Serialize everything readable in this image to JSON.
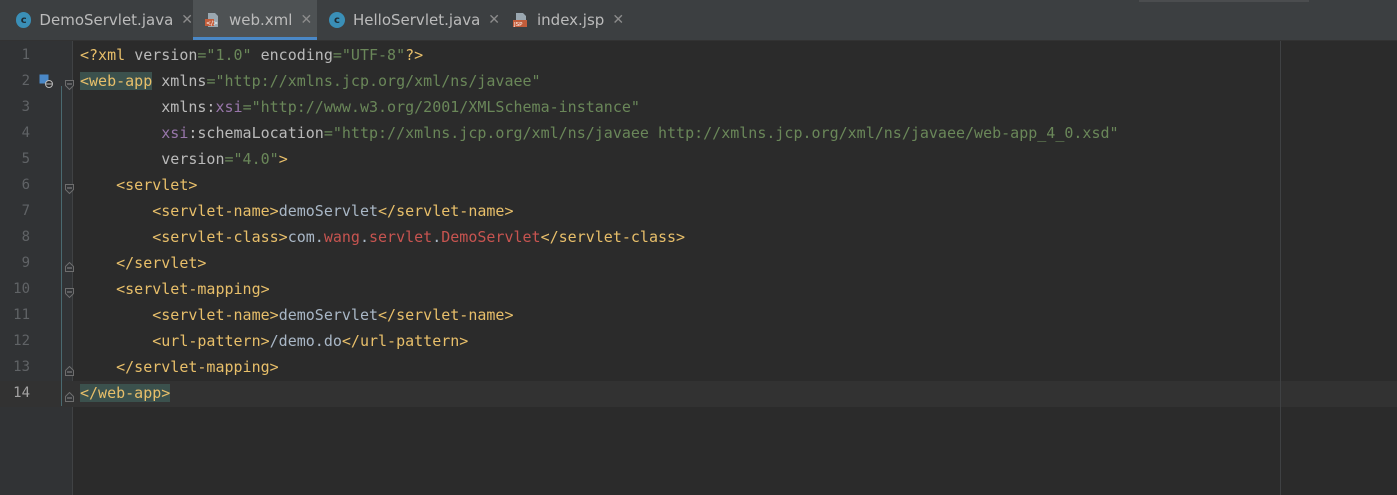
{
  "tabs": [
    {
      "label": "DemoServlet.java",
      "icon": "java-class-icon",
      "active": false
    },
    {
      "label": "web.xml",
      "icon": "xml-file-icon",
      "active": true
    },
    {
      "label": "HelloServlet.java",
      "icon": "java-class-icon",
      "active": false
    },
    {
      "label": "index.jsp",
      "icon": "jsp-file-icon",
      "active": false
    }
  ],
  "tab_close_glyph": "✕",
  "class_icon_letter": "c",
  "jsp_icon_text": "JSP",
  "colors": {
    "background": "#2b2b2b",
    "tag": "#e8bf6a",
    "attribute_value": "#6a8759",
    "namespace_prefix": "#9876aa",
    "active_tab_underline": "#4a88c7"
  },
  "editor": {
    "current_line": 14,
    "lines": [
      {
        "num": "1",
        "tokens": [
          [
            "t-tag",
            "<?xml "
          ],
          [
            "t-attr",
            "version"
          ],
          [
            "t-val",
            "=\"1.0\" "
          ],
          [
            "t-attr",
            "encoding"
          ],
          [
            "t-val",
            "=\"UTF-8\""
          ],
          [
            "t-tag",
            "?>"
          ]
        ]
      },
      {
        "num": "2",
        "tokens": [
          [
            "t-tag hl",
            "<web-app"
          ],
          [
            "t-attr",
            " xmlns"
          ],
          [
            "t-val",
            "=\"http://xmlns.jcp.org/xml/ns/javaee\""
          ]
        ]
      },
      {
        "num": "3",
        "tokens": [
          [
            "t-attr",
            "         xmlns:"
          ],
          [
            "t-ns",
            "xsi"
          ],
          [
            "t-val",
            "=\"http://www.w3.org/2001/XMLSchema-instance\""
          ]
        ]
      },
      {
        "num": "4",
        "tokens": [
          [
            "t-ns",
            "         xsi"
          ],
          [
            "t-attr",
            ":schemaLocation"
          ],
          [
            "t-val",
            "=\"http://xmlns.jcp.org/xml/ns/javaee http://xmlns.jcp.org/xml/ns/javaee/web-app_4_0.xsd\""
          ]
        ]
      },
      {
        "num": "5",
        "tokens": [
          [
            "t-attr",
            "         version"
          ],
          [
            "t-val",
            "=\"4.0\""
          ],
          [
            "t-tag",
            ">"
          ]
        ]
      },
      {
        "num": "6",
        "tokens": [
          [
            "t-tag",
            "    <servlet>"
          ]
        ]
      },
      {
        "num": "7",
        "tokens": [
          [
            "t-tag",
            "        <servlet-name>"
          ],
          [
            "t-txt",
            "demoServlet"
          ],
          [
            "t-tag",
            "</servlet-name>"
          ]
        ]
      },
      {
        "num": "8",
        "tokens": [
          [
            "t-tag",
            "        <servlet-class>"
          ],
          [
            "t-txt",
            "com."
          ],
          [
            "t-pkg",
            "wang"
          ],
          [
            "t-txt",
            "."
          ],
          [
            "t-pkg",
            "servlet"
          ],
          [
            "t-txt",
            "."
          ],
          [
            "t-pkg",
            "DemoServlet"
          ],
          [
            "t-tag",
            "</servlet-class>"
          ]
        ]
      },
      {
        "num": "9",
        "tokens": [
          [
            "t-tag",
            "    </servlet>"
          ]
        ]
      },
      {
        "num": "10",
        "tokens": [
          [
            "t-tag",
            "    <servlet-mapping>"
          ]
        ]
      },
      {
        "num": "11",
        "tokens": [
          [
            "t-tag",
            "        <servlet-name>"
          ],
          [
            "t-txt",
            "demoServlet"
          ],
          [
            "t-tag",
            "</servlet-name>"
          ]
        ]
      },
      {
        "num": "12",
        "tokens": [
          [
            "t-tag",
            "        <url-pattern>"
          ],
          [
            "t-txt",
            "/demo.do"
          ],
          [
            "t-tag",
            "</url-pattern>"
          ]
        ]
      },
      {
        "num": "13",
        "tokens": [
          [
            "t-tag",
            "    </servlet-mapping>"
          ]
        ]
      },
      {
        "num": "14",
        "tokens": [
          [
            "t-tag hl",
            "</web-app>"
          ]
        ]
      }
    ],
    "fold_open_lines": [
      2,
      6,
      10
    ],
    "fold_close_lines": [
      9,
      13,
      14
    ],
    "gutter_icon_line": 2
  }
}
